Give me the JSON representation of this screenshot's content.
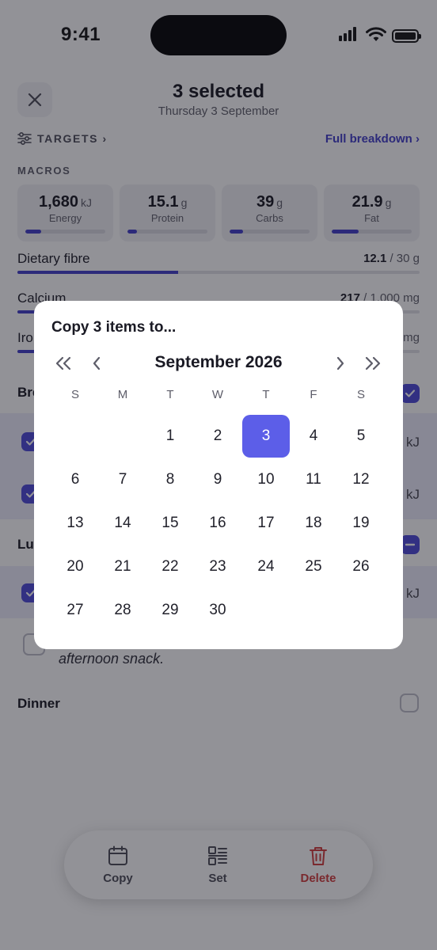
{
  "status_bar": {
    "time": "9:41"
  },
  "header": {
    "title": "3 selected",
    "subtitle": "Thursday 3 September",
    "targets_label": "TARGETS ›",
    "full_breakdown_label": "Full breakdown ›"
  },
  "macros": {
    "section_label": "MACROS",
    "cards": [
      {
        "value": "1,680",
        "unit": "kJ",
        "name": "Energy",
        "progress": 0.2
      },
      {
        "value": "15.1",
        "unit": "g",
        "name": "Protein",
        "progress": 0.12
      },
      {
        "value": "39",
        "unit": "g",
        "name": "Carbs",
        "progress": 0.17
      },
      {
        "value": "21.9",
        "unit": "g",
        "name": "Fat",
        "progress": 0.34
      }
    ]
  },
  "nutrients": [
    {
      "name": "Dietary fibre",
      "amount": "12.1",
      "target": "/ 30 g",
      "progress": 0.4
    },
    {
      "name": "Calcium",
      "amount": "217",
      "target": "/ 1,000 mg",
      "progress": 0.22
    },
    {
      "name": "Iro",
      "amount": "",
      "target": "mg",
      "progress": 0.3
    }
  ],
  "meals": {
    "breakfast_label": "Bre",
    "breakfast_row_values": [
      "kJ",
      "kJ"
    ],
    "lunch_label": "Lu",
    "lunch_row_values": [
      "kJ"
    ],
    "snack_text": "afternoon snack.",
    "dinner_label": "Dinner"
  },
  "copy_dialog": {
    "title": "Copy 3 items to...",
    "month_label": "September 2026",
    "weekdays": [
      "S",
      "M",
      "T",
      "W",
      "T",
      "F",
      "S"
    ],
    "first_weekday_index": 2,
    "days_in_month": 30,
    "selected_day": 3,
    "days": [
      "1",
      "2",
      "3",
      "4",
      "5",
      "6",
      "7",
      "8",
      "9",
      "10",
      "11",
      "12",
      "13",
      "14",
      "15",
      "16",
      "17",
      "18",
      "19",
      "20",
      "21",
      "22",
      "23",
      "24",
      "25",
      "26",
      "27",
      "28",
      "29",
      "30"
    ]
  },
  "toolbar": {
    "copy_label": "Copy",
    "set_label": "Set",
    "delete_label": "Delete"
  },
  "colors": {
    "accent": "#3f3cc8",
    "selected_day": "#5c5ee8",
    "danger": "#d23a3a"
  }
}
